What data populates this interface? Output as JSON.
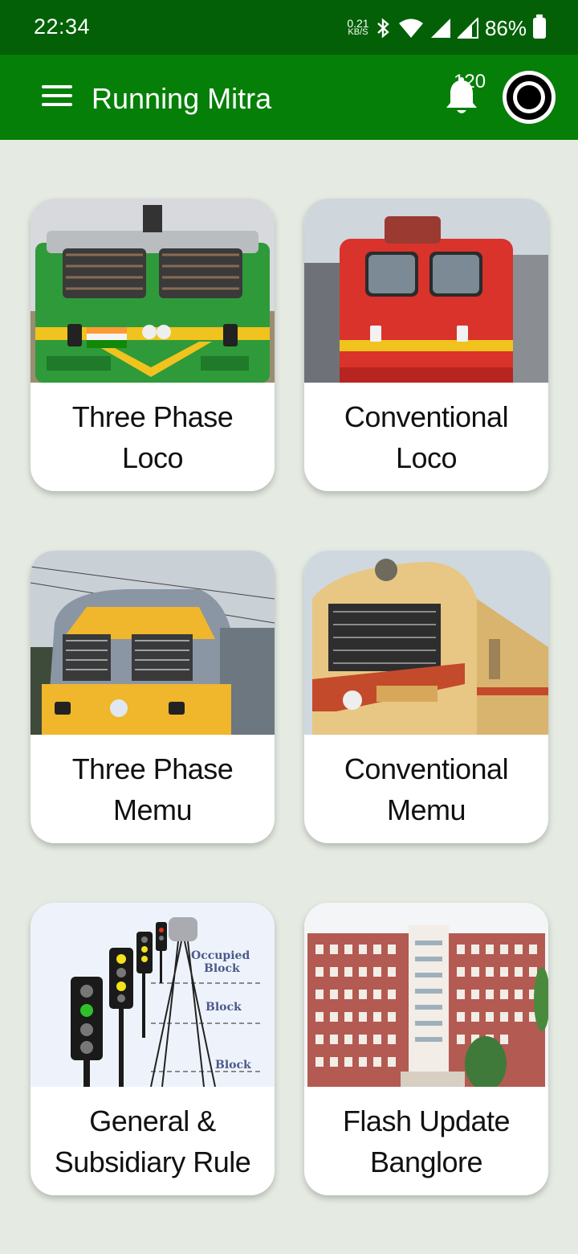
{
  "status_bar": {
    "time": "22:34",
    "net_speed_value": "0.21",
    "net_speed_unit": "KB/S",
    "battery": "86%",
    "icons": [
      "bluetooth-icon",
      "wifi-icon",
      "signal-icon",
      "signal-icon",
      "battery-icon"
    ]
  },
  "app_bar": {
    "title": "Running Mitra",
    "notification_count": "120",
    "colors": {
      "status_bar": "#036006",
      "app_bar": "#067f08",
      "background": "#e5ebe3"
    }
  },
  "cards": [
    {
      "line1": "Three Phase",
      "line2": "Loco",
      "image": "green-wag9-locomotive"
    },
    {
      "line1": "Conventional",
      "line2": "Loco",
      "image": "red-wap4-locomotive"
    },
    {
      "line1": "Three Phase",
      "line2": "Memu",
      "image": "three-phase-memu-train"
    },
    {
      "line1": "Conventional",
      "line2": "Memu",
      "image": "conventional-memu-train"
    },
    {
      "line1": "General &",
      "line2": "Subsidiary Rule",
      "image": "railway-signals-diagram",
      "image_text": [
        "Occupied",
        "Block",
        "Block",
        "Block"
      ]
    },
    {
      "line1": "Flash Update",
      "line2": "Banglore",
      "image": "railway-office-building"
    }
  ]
}
